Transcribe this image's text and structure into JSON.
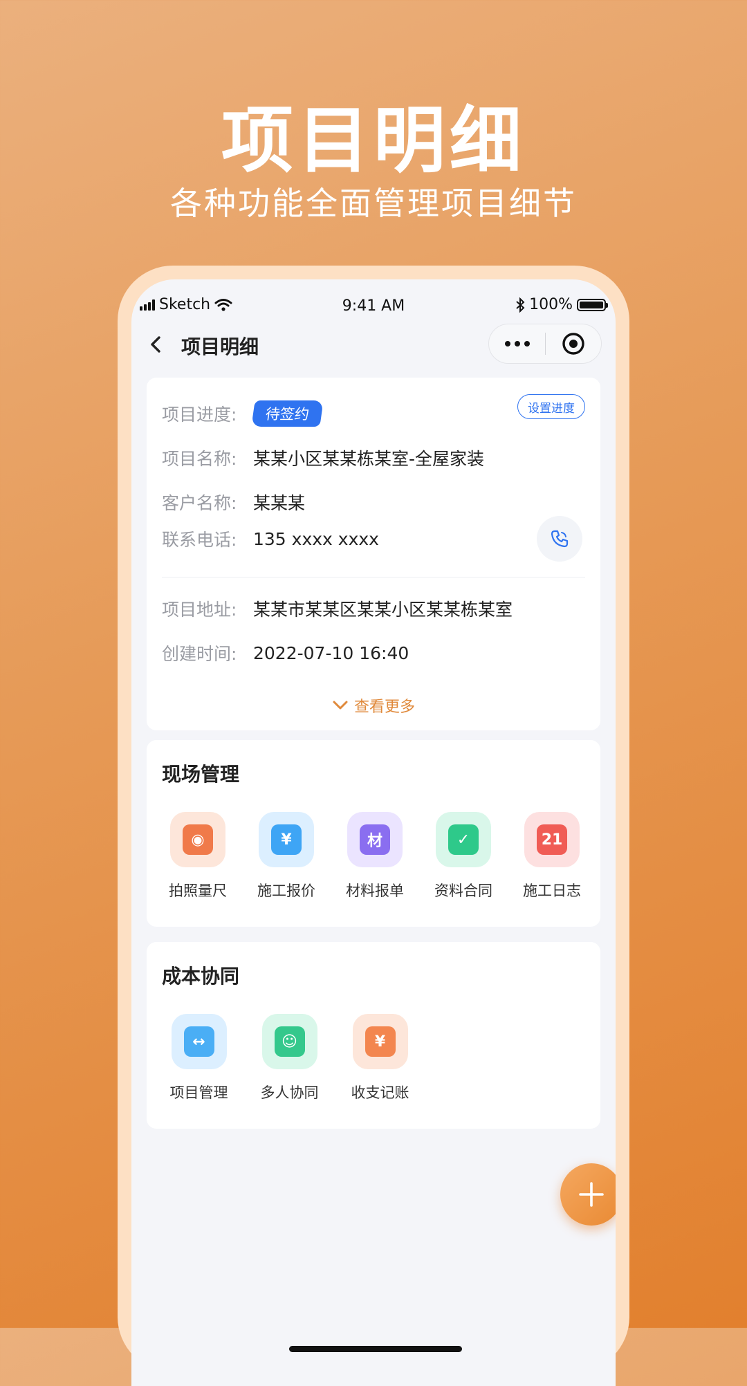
{
  "promo": {
    "title": "项目明细",
    "subtitle": "各种功能全面管理项目细节"
  },
  "status_bar": {
    "carrier": "Sketch",
    "time": "9:41 AM",
    "battery": "100%",
    "battery_level": 1.0
  },
  "nav": {
    "title": "项目明细",
    "back_icon": "chevron-left-icon",
    "more_icon": "more-dots-icon",
    "close_icon": "target-circle-icon"
  },
  "project_info": {
    "progress_label": "项目进度:",
    "progress_status": "待签约",
    "set_progress_button": "设置进度",
    "name_label": "项目名称:",
    "name_value": "某某小区某某栋某室-全屋家装",
    "customer_label": "客户名称:",
    "customer_value": "某某某",
    "phone_label": "联系电话:",
    "phone_value": "135 xxxx xxxx",
    "address_label": "项目地址:",
    "address_value": "某某市某某区某某小区某某栋某室",
    "created_label": "创建时间:",
    "created_value": "2022-07-10  16:40",
    "view_more": "查看更多",
    "colors": {
      "accent_blue": "#2f73f0",
      "accent_orange": "#e08a3c"
    }
  },
  "site_management": {
    "title": "现场管理",
    "tools": [
      {
        "label": "拍照量尺",
        "icon": "camera-icon",
        "glyph": "◉",
        "bg": "#fde6da",
        "core": "#f07a4a"
      },
      {
        "label": "施工报价",
        "icon": "quote-doc-icon",
        "glyph": "¥",
        "bg": "#dcefff",
        "core": "#3ea5f5"
      },
      {
        "label": "材料报单",
        "icon": "material-clipboard-icon",
        "glyph": "材",
        "bg": "#ebe4ff",
        "core": "#8a6ef0"
      },
      {
        "label": "资料合同",
        "icon": "contract-doc-icon",
        "glyph": "✓",
        "bg": "#d9f7ea",
        "core": "#2ec98a"
      },
      {
        "label": "施工日志",
        "icon": "calendar-log-icon",
        "glyph": "21",
        "bg": "#fde0e0",
        "core": "#f05c55"
      }
    ]
  },
  "cost_collaboration": {
    "title": "成本协同",
    "tools": [
      {
        "label": "项目管理",
        "icon": "briefcase-icon",
        "glyph": "↔",
        "bg": "#dcefff",
        "core": "#4aaef5"
      },
      {
        "label": "多人协同",
        "icon": "team-users-icon",
        "glyph": "☺",
        "bg": "#d9f7ea",
        "core": "#34c88c"
      },
      {
        "label": "收支记账",
        "icon": "ledger-icon",
        "glyph": "¥",
        "bg": "#fde6da",
        "core": "#f3864f"
      }
    ]
  },
  "fab": {
    "icon": "plus-icon"
  }
}
